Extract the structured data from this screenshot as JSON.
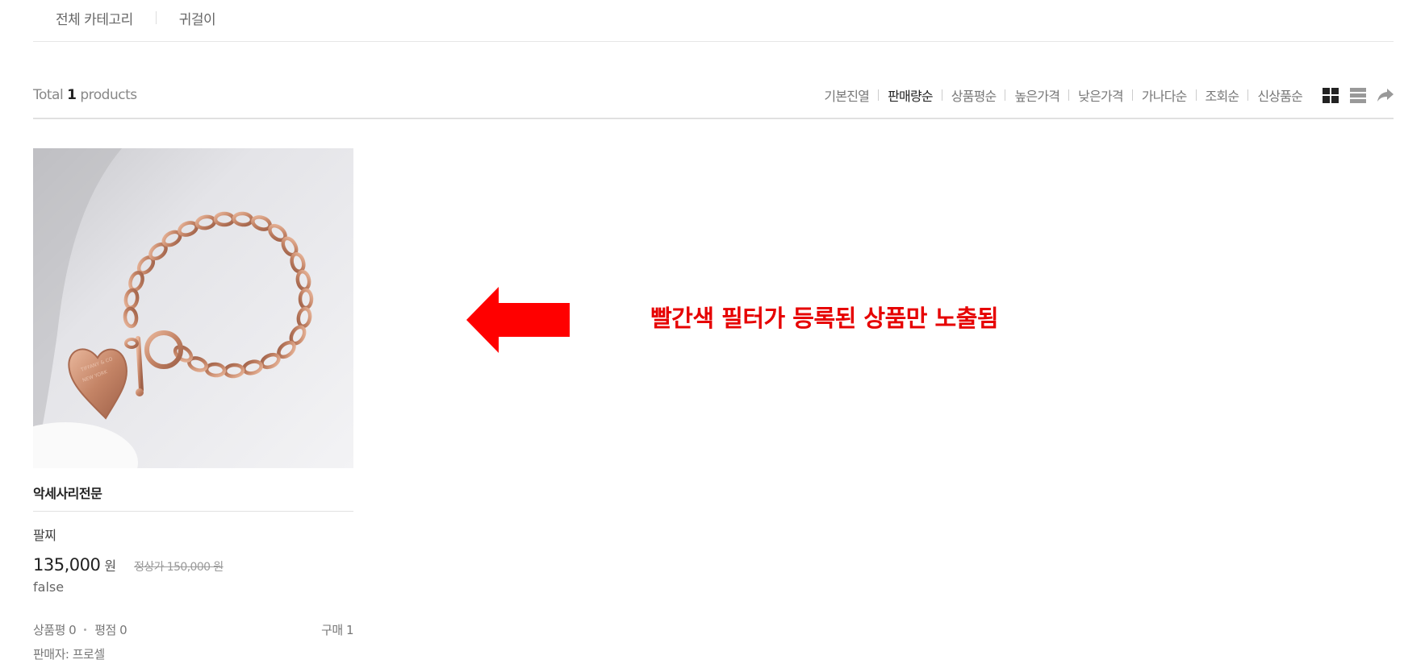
{
  "breadcrumb": {
    "items": [
      "전체 카테고리",
      "귀걸이"
    ]
  },
  "toolbar": {
    "total_prefix": "Total ",
    "total_count": "1",
    "total_suffix": " products",
    "sort_options": [
      "기본진열",
      "판매량순",
      "상품평순",
      "높은가격",
      "낮은가격",
      "가나다순",
      "조회순",
      "신상품순"
    ],
    "active_sort": "판매량순",
    "view_icons": [
      "grid-view-icon",
      "list-view-icon",
      "share-icon"
    ]
  },
  "product": {
    "seller_name": "악세사리전문",
    "name": "팔찌",
    "price": "135,000",
    "price_unit": "원",
    "original_price": "정상가 150,000 원",
    "flag": "false",
    "review_count": "상품평 0",
    "rating": "평점 0",
    "purchase_count": "구매 1",
    "seller": "판매자: 프로셀",
    "image": "rose-gold-heart-bracelet"
  },
  "annotation": {
    "text": "빨간색 필터가 등록된 상품만 노출됨",
    "color": "#e60000",
    "arrow": "left-pointing-red-arrow"
  }
}
